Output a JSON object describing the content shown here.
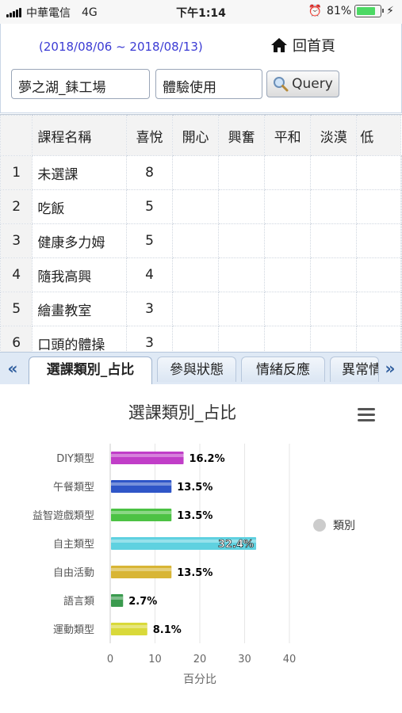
{
  "status_bar": {
    "carrier": "中華電信",
    "network": "4G",
    "time": "下午1:14",
    "battery": "81%",
    "battery_level": 0.81
  },
  "header": {
    "date_range": "(2018/08/06 ~ 2018/08/13)",
    "home_label": "回首頁",
    "location": "夢之湖_銇工場",
    "usage": "體驗使用",
    "query_label": "Query"
  },
  "grid": {
    "columns": [
      "課程名稱",
      "喜悅",
      "開心",
      "興奮",
      "平和",
      "淡漠",
      "低"
    ],
    "rows": [
      {
        "idx": "1",
        "name": "未選課",
        "values": [
          "8",
          "",
          "",
          "",
          "",
          ""
        ]
      },
      {
        "idx": "2",
        "name": "吃飯",
        "values": [
          "5",
          "",
          "",
          "",
          "",
          ""
        ]
      },
      {
        "idx": "3",
        "name": "健康多力姆",
        "values": [
          "5",
          "",
          "",
          "",
          "",
          ""
        ]
      },
      {
        "idx": "4",
        "name": "隨我高興",
        "values": [
          "4",
          "",
          "",
          "",
          "",
          ""
        ]
      },
      {
        "idx": "5",
        "name": "繪畫教室",
        "values": [
          "3",
          "",
          "",
          "",
          "",
          ""
        ]
      },
      {
        "idx": "6",
        "name": "口頭的體操",
        "values": [
          "3",
          "",
          "",
          "",
          "",
          ""
        ]
      }
    ]
  },
  "tabs": {
    "prev": "«",
    "next": "»",
    "items": [
      "選課類別_占比",
      "參與狀態",
      "情緒反應",
      "異常情"
    ]
  },
  "chart_data": {
    "type": "bar",
    "title": "選課類別_占比",
    "categories": [
      "DIY類型",
      "午餐類型",
      "益智遊戲類型",
      "自主類型",
      "自由活動",
      "語言類",
      "運動類型"
    ],
    "series": [
      {
        "name": "類別",
        "values": [
          16.2,
          13.5,
          13.5,
          32.4,
          13.5,
          2.7,
          8.1
        ]
      }
    ],
    "data_labels": [
      "16.2%",
      "13.5%",
      "13.5%",
      "32.4%",
      "13.5%",
      "2.7%",
      "8.1%"
    ],
    "colors": [
      "#c13ec8",
      "#2f56c8",
      "#4cc244",
      "#5fd1e0",
      "#d8b535",
      "#3a9a4e",
      "#d9d93a"
    ],
    "xlabel": "百分比",
    "xticks": [
      "0",
      "10",
      "20",
      "30",
      "40"
    ],
    "xlim": [
      0,
      40
    ],
    "legend_position": "right",
    "grid": true
  }
}
